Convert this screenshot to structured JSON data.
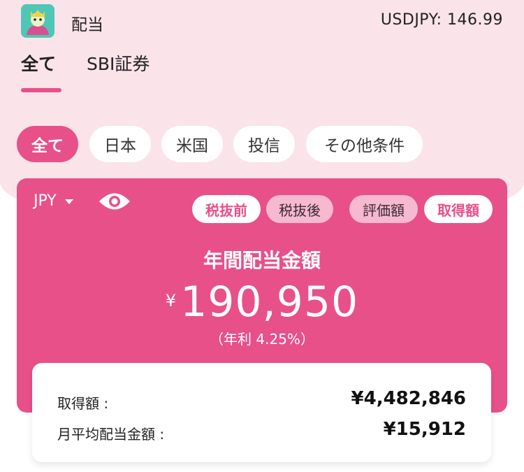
{
  "header": {
    "title": "配当",
    "rate": "USDJPY: 146.99"
  },
  "broker_tabs": [
    {
      "label": "全て",
      "active": true
    },
    {
      "label": "SBI証券",
      "active": false
    }
  ],
  "filter_chips": [
    {
      "label": "全て",
      "active": true
    },
    {
      "label": "日本",
      "active": false
    },
    {
      "label": "米国",
      "active": false
    },
    {
      "label": "投信",
      "active": false
    },
    {
      "label": "その他条件",
      "active": false
    }
  ],
  "card": {
    "currency": "JPY",
    "tax_toggle": [
      {
        "label": "税抜前",
        "active": true
      },
      {
        "label": "税抜後",
        "active": false
      }
    ],
    "basis_toggle": [
      {
        "label": "評価額",
        "active": false
      },
      {
        "label": "取得額",
        "active": true
      }
    ],
    "title": "年間配当金額",
    "currency_symbol": "¥",
    "amount": "190,950",
    "yield_text": "（年利 4.25%）"
  },
  "details": [
    {
      "label": "取得額 :",
      "value": "¥4,482,846"
    },
    {
      "label": "月平均配当金額 :",
      "value": "¥15,912"
    }
  ],
  "colors": {
    "accent": "#e8508a",
    "background_tint": "#fbe3ea",
    "pill_inactive": "#f7b9cf"
  },
  "icons": {
    "app": "app-logo-icon",
    "eye": "eye-icon",
    "dropdown": "caret-down-icon"
  }
}
